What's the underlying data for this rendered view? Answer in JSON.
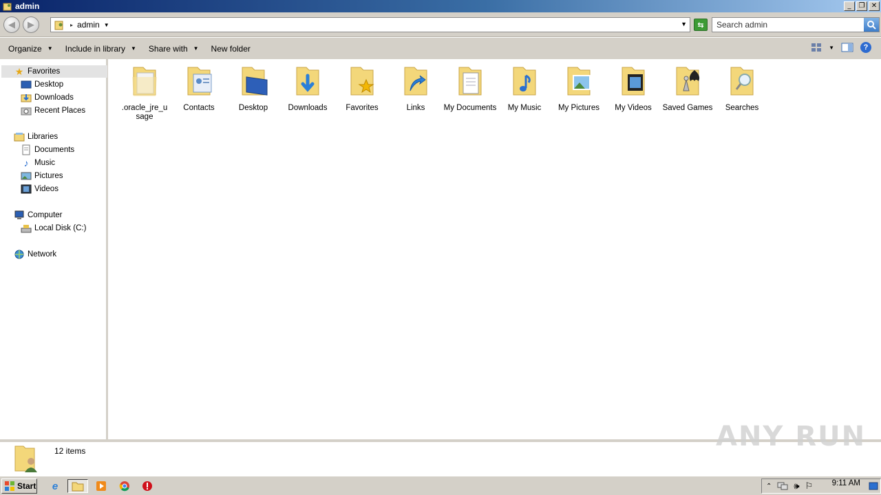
{
  "window": {
    "title": "admin"
  },
  "address": {
    "crumb": "admin"
  },
  "search": {
    "placeholder": "Search admin"
  },
  "commands": {
    "organize": "Organize",
    "include_in_library": "Include in library",
    "share_with": "Share with",
    "new_folder": "New folder"
  },
  "nav": {
    "favorites": "Favorites",
    "desktop": "Desktop",
    "downloads": "Downloads",
    "recent_places": "Recent Places",
    "libraries": "Libraries",
    "documents": "Documents",
    "music": "Music",
    "pictures": "Pictures",
    "videos": "Videos",
    "computer": "Computer",
    "local_disk": "Local Disk (C:)",
    "network": "Network"
  },
  "items": [
    {
      "label": ".oracle_jre_u sage",
      "icon": "blank-folder-icon"
    },
    {
      "label": "Contacts",
      "icon": "contacts-folder-icon"
    },
    {
      "label": "Desktop",
      "icon": "desktop-folder-icon"
    },
    {
      "label": "Downloads",
      "icon": "downloads-folder-icon"
    },
    {
      "label": "Favorites",
      "icon": "favorites-folder-icon"
    },
    {
      "label": "Links",
      "icon": "links-folder-icon"
    },
    {
      "label": "My Documents",
      "icon": "documents-folder-icon"
    },
    {
      "label": "My Music",
      "icon": "music-folder-icon"
    },
    {
      "label": "My Pictures",
      "icon": "pictures-folder-icon"
    },
    {
      "label": "My Videos",
      "icon": "videos-folder-icon"
    },
    {
      "label": "Saved Games",
      "icon": "games-folder-icon"
    },
    {
      "label": "Searches",
      "icon": "searches-folder-icon"
    }
  ],
  "status": {
    "count": "12 items"
  },
  "watermark": "ANY RUN",
  "taskbar": {
    "start": "Start",
    "clock": "9:11 AM"
  },
  "colors": {
    "titlebar_start": "#0a246a",
    "titlebar_end": "#a6caf0",
    "chrome": "#d4d0c8",
    "folder": "#f3d77a"
  }
}
